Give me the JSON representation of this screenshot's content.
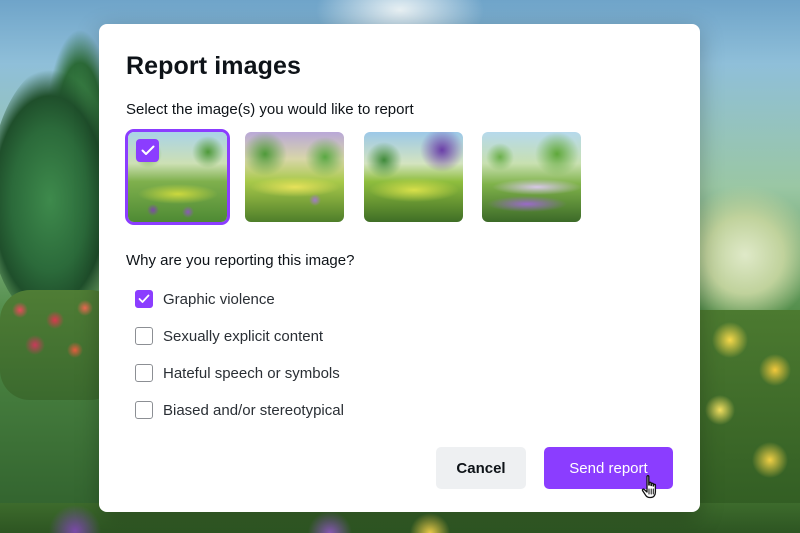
{
  "modal": {
    "title": "Report images",
    "images_prompt": "Select the image(s) you would like to report",
    "images": [
      {
        "selected": true
      },
      {
        "selected": false
      },
      {
        "selected": false
      },
      {
        "selected": false
      }
    ],
    "reasons_prompt": "Why are you reporting this image?",
    "reasons": [
      {
        "label": "Graphic violence",
        "checked": true
      },
      {
        "label": "Sexually explicit content",
        "checked": false
      },
      {
        "label": "Hateful speech or symbols",
        "checked": false
      },
      {
        "label": "Biased and/or stereotypical",
        "checked": false
      }
    ],
    "cancel_label": "Cancel",
    "send_label": "Send report"
  },
  "colors": {
    "accent": "#8b3dff",
    "cancel_bg": "#eef0f2",
    "text": "#0e1318"
  },
  "icons": {
    "checkmark": "check-icon",
    "cursor": "hand-pointer-icon"
  }
}
